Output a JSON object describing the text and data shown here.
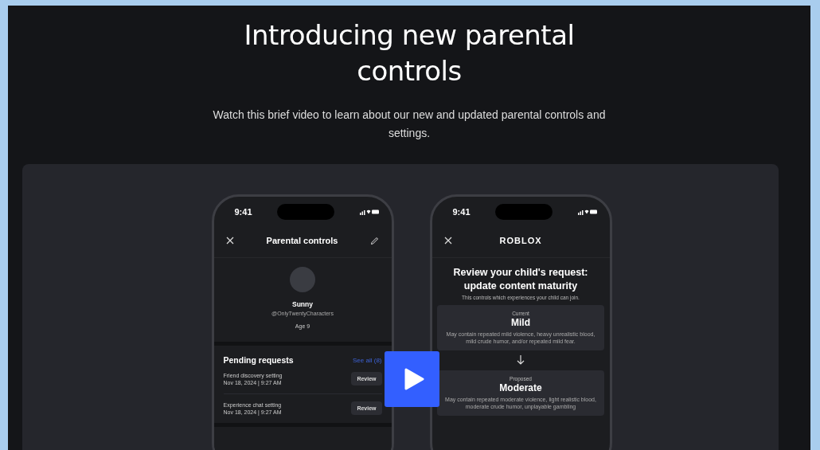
{
  "page": {
    "title": "Introducing new parental controls",
    "subtitle": "Watch this brief video to learn about our new and updated parental controls and settings."
  },
  "phones": [
    {
      "kind": "profile",
      "time": "9:41",
      "header_title": "Parental controls",
      "profile": {
        "name": "Sunny",
        "handle": "@OnlyTwentyCharacters",
        "age": "Age 9"
      },
      "section": {
        "title": "Pending requests",
        "link": "See all (8)",
        "requests": [
          {
            "title": "Friend discovery setting",
            "date": "Nov 18, 2024 | 9:27 AM",
            "action": "Review"
          },
          {
            "title": "Experience chat setting",
            "date": "Nov 18, 2024 | 9:27 AM",
            "action": "Review"
          }
        ]
      }
    },
    {
      "kind": "review",
      "time": "9:41",
      "logo": "ROBLOX",
      "heading": "Review your child's request: update content maturity",
      "note": "This controls which experiences your child can join.",
      "options": [
        {
          "label": "Current",
          "name": "Mild",
          "description": "May contain repeated mild violence, heavy unrealistic blood, mild crude humor, and/or repeated mild fear."
        },
        {
          "label": "Proposed",
          "name": "Moderate",
          "description": "May contain repeated moderate violence, light realistic blood, moderate crude humor, unplayable gambling"
        }
      ]
    }
  ]
}
